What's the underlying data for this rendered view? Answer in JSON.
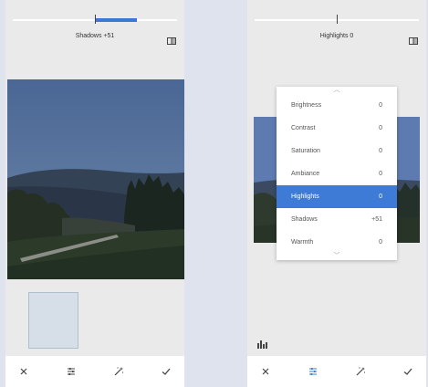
{
  "left_screen": {
    "adjustment_label": "Shadows +51",
    "slider_fraction": 0.51,
    "toolbar": {
      "cancel_icon": "close-icon",
      "tune_icon": "sliders-icon",
      "auto_icon": "magic-wand-icon",
      "apply_icon": "checkmark-icon"
    }
  },
  "right_screen": {
    "adjustment_label": "Highlights 0",
    "slider_fraction": 0,
    "menu": {
      "items": [
        {
          "label": "Brightness",
          "value": "0"
        },
        {
          "label": "Contrast",
          "value": "0"
        },
        {
          "label": "Saturation",
          "value": "0"
        },
        {
          "label": "Ambiance",
          "value": "0"
        },
        {
          "label": "Highlights",
          "value": "0"
        },
        {
          "label": "Shadows",
          "value": "+51"
        },
        {
          "label": "Warmth",
          "value": "0"
        }
      ],
      "selected": "Highlights"
    },
    "toolbar": {
      "cancel_icon": "close-icon",
      "tune_icon": "sliders-icon",
      "auto_icon": "magic-wand-icon",
      "apply_icon": "checkmark-icon"
    }
  },
  "colors": {
    "accent": "#3a78d8",
    "background": "#dfe3ee",
    "panel": "#eaeaea",
    "sky": "#4a6794"
  }
}
